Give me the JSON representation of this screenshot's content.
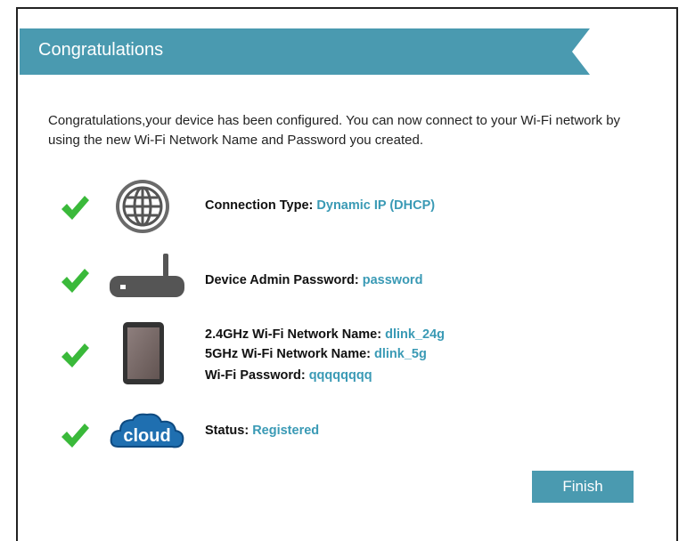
{
  "banner": {
    "title": "Congratulations",
    "color": "#4a9ab0"
  },
  "intro": "Congratulations,your device has been configured. You can now connect to your Wi-Fi network by using the new Wi-Fi Network Name and Password you created.",
  "items": {
    "connection": {
      "label": "Connection Type:",
      "value": "Dynamic IP (DHCP)",
      "icon": "globe-icon"
    },
    "admin": {
      "label": "Device Admin Password:",
      "value": "password",
      "icon": "router-icon"
    },
    "wifi24": {
      "label": "2.4GHz Wi-Fi Network Name:",
      "value": "dlink_24g",
      "icon": "tablet-icon"
    },
    "wifi5": {
      "label": "5GHz Wi-Fi Network Name:",
      "value": "dlink_5g"
    },
    "wifipass": {
      "label": "Wi-Fi Password:",
      "value": "qqqqqqqq"
    },
    "status": {
      "label": "Status:",
      "value": "Registered",
      "icon": "cloud-icon"
    }
  },
  "buttons": {
    "finish": "Finish"
  },
  "colors": {
    "accent": "#3a9ab5",
    "check": "#3ab93a"
  }
}
